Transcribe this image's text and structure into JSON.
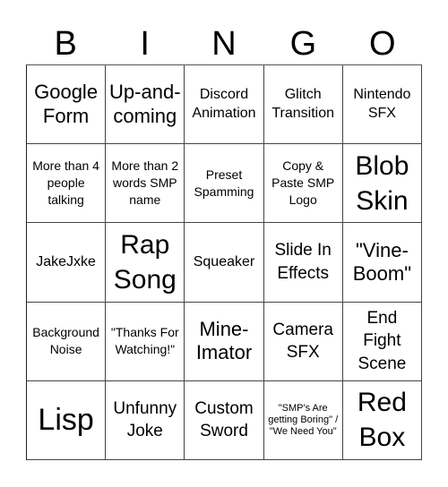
{
  "header": {
    "letters": [
      "B",
      "I",
      "N",
      "G",
      "O"
    ]
  },
  "board": {
    "rows": [
      [
        "Google Form",
        "Up-and-coming",
        "Discord Animation",
        "Glitch Transition",
        "Nintendo SFX"
      ],
      [
        "More than 4 people talking",
        "More than 2 words SMP name",
        "Preset Spamming",
        "Copy & Paste SMP Logo",
        "Blob Skin"
      ],
      [
        "JakeJxke",
        "Rap Song",
        "Squeaker",
        "Slide In Effects",
        "\"Vine-Boom\""
      ],
      [
        "Background Noise",
        "\"Thanks For Watching!\"",
        "Mine-Imator",
        "Camera SFX",
        "End Fight Scene"
      ],
      [
        "Lisp",
        "Unfunny Joke",
        "Custom Sword",
        "\"SMP's Are getting Boring\" / \"We Need You\"",
        "Red Box"
      ]
    ]
  },
  "colors": {
    "background": "#ffffff",
    "text": "#000000",
    "grid_line": "#444444"
  }
}
